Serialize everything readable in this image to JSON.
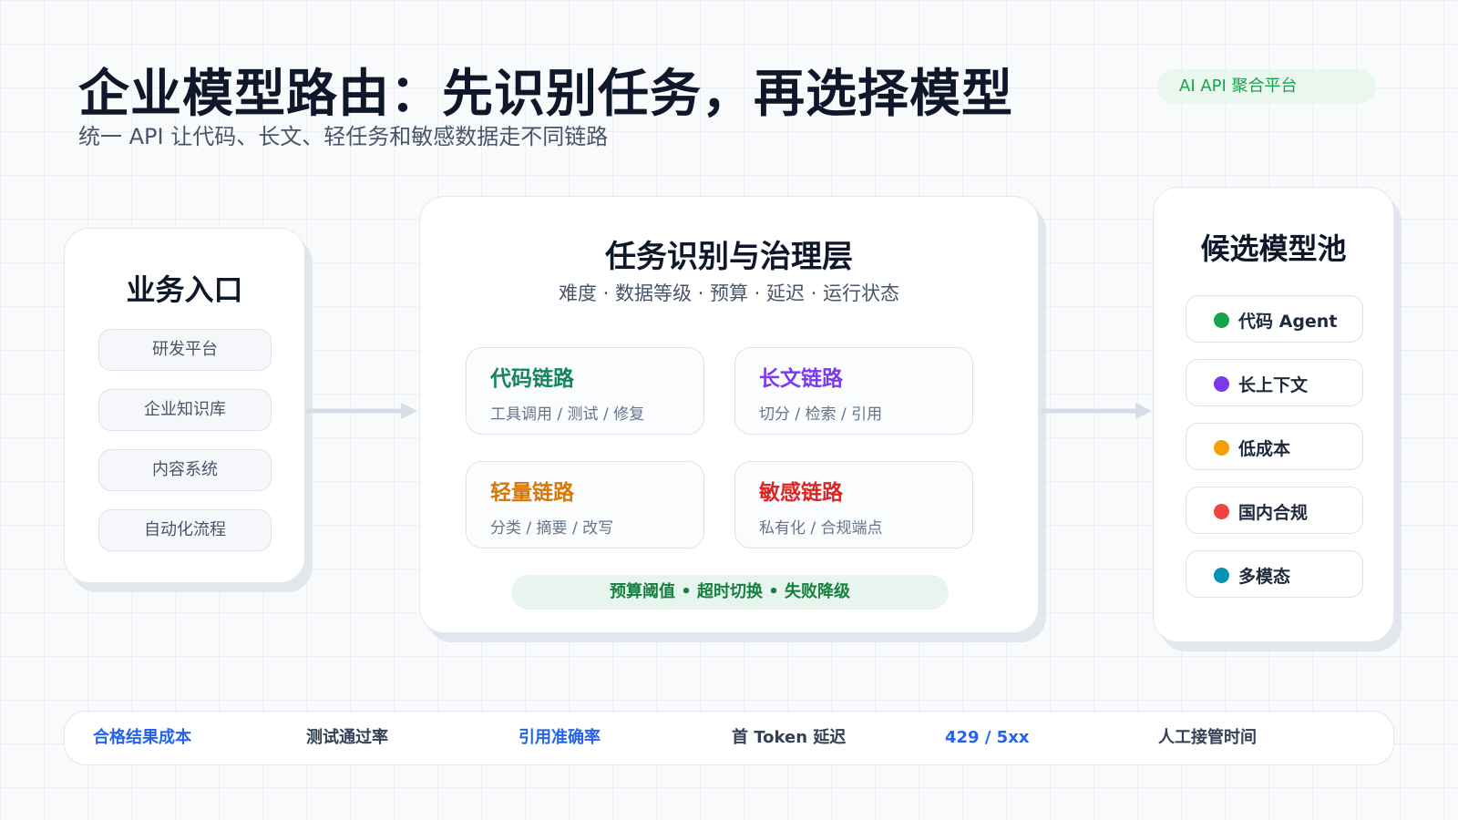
{
  "header": {
    "title": "企业模型路由：先识别任务，再选择模型",
    "subtitle": "统一 API 让代码、长文、轻任务和敏感数据走不同链路",
    "badge": "AI API 聚合平台"
  },
  "entry": {
    "title": "业务入口",
    "items": [
      "研发平台",
      "企业知识库",
      "内容系统",
      "自动化流程"
    ]
  },
  "core": {
    "title": "任务识别与治理层",
    "subtitle": "难度 · 数据等级 · 预算 · 延迟 · 运行状态",
    "chains": [
      {
        "name": "代码链路",
        "desc": "工具调用 / 测试 / 修复",
        "color": "#16865a"
      },
      {
        "name": "长文链路",
        "desc": "切分 / 检索 / 引用",
        "color": "#7c3aed"
      },
      {
        "name": "轻量链路",
        "desc": "分类 / 摘要 / 改写",
        "color": "#d97706"
      },
      {
        "name": "敏感链路",
        "desc": "私有化 / 合规端点",
        "color": "#dc2626"
      }
    ],
    "policy": "预算阈值 • 超时切换 • 失败降级"
  },
  "pool": {
    "title": "候选模型池",
    "items": [
      {
        "label": "代码 Agent",
        "color": "#16a34a"
      },
      {
        "label": "长上下文",
        "color": "#7c3aed"
      },
      {
        "label": "低成本",
        "color": "#f59e0b"
      },
      {
        "label": "国内合规",
        "color": "#ef4444"
      },
      {
        "label": "多模态",
        "color": "#0891b2"
      }
    ]
  },
  "metrics": [
    {
      "label": "合格结果成本",
      "color": "#2563eb"
    },
    {
      "label": "测试通过率",
      "color": "#334155"
    },
    {
      "label": "引用准确率",
      "color": "#2563eb"
    },
    {
      "label": "首 Token 延迟",
      "color": "#334155"
    },
    {
      "label": "429 / 5xx",
      "color": "#2563eb"
    },
    {
      "label": "人工接管时间",
      "color": "#334155"
    }
  ],
  "colors": {
    "arrow": "#d6dde6"
  }
}
